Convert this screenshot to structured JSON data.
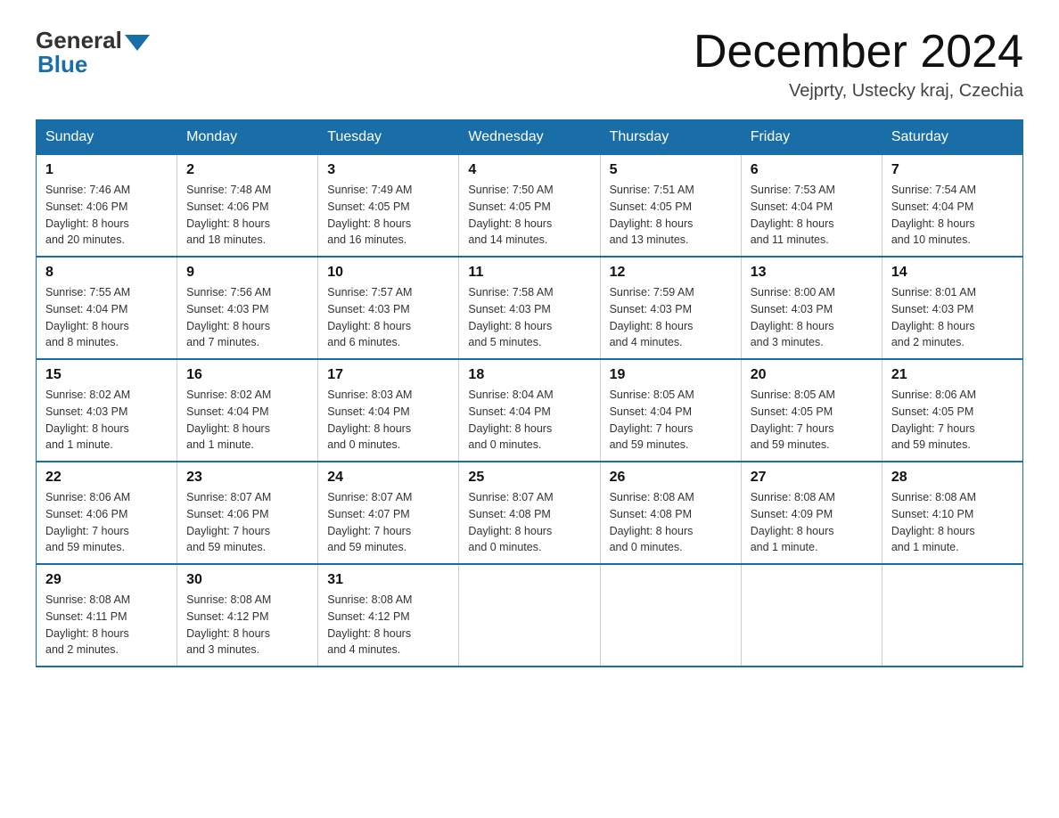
{
  "logo": {
    "general": "General",
    "blue": "Blue"
  },
  "title": "December 2024",
  "location": "Vejprty, Ustecky kraj, Czechia",
  "weekdays": [
    "Sunday",
    "Monday",
    "Tuesday",
    "Wednesday",
    "Thursday",
    "Friday",
    "Saturday"
  ],
  "weeks": [
    [
      {
        "day": "1",
        "sunrise": "7:46 AM",
        "sunset": "4:06 PM",
        "daylight": "8 hours and 20 minutes."
      },
      {
        "day": "2",
        "sunrise": "7:48 AM",
        "sunset": "4:06 PM",
        "daylight": "8 hours and 18 minutes."
      },
      {
        "day": "3",
        "sunrise": "7:49 AM",
        "sunset": "4:05 PM",
        "daylight": "8 hours and 16 minutes."
      },
      {
        "day": "4",
        "sunrise": "7:50 AM",
        "sunset": "4:05 PM",
        "daylight": "8 hours and 14 minutes."
      },
      {
        "day": "5",
        "sunrise": "7:51 AM",
        "sunset": "4:05 PM",
        "daylight": "8 hours and 13 minutes."
      },
      {
        "day": "6",
        "sunrise": "7:53 AM",
        "sunset": "4:04 PM",
        "daylight": "8 hours and 11 minutes."
      },
      {
        "day": "7",
        "sunrise": "7:54 AM",
        "sunset": "4:04 PM",
        "daylight": "8 hours and 10 minutes."
      }
    ],
    [
      {
        "day": "8",
        "sunrise": "7:55 AM",
        "sunset": "4:04 PM",
        "daylight": "8 hours and 8 minutes."
      },
      {
        "day": "9",
        "sunrise": "7:56 AM",
        "sunset": "4:03 PM",
        "daylight": "8 hours and 7 minutes."
      },
      {
        "day": "10",
        "sunrise": "7:57 AM",
        "sunset": "4:03 PM",
        "daylight": "8 hours and 6 minutes."
      },
      {
        "day": "11",
        "sunrise": "7:58 AM",
        "sunset": "4:03 PM",
        "daylight": "8 hours and 5 minutes."
      },
      {
        "day": "12",
        "sunrise": "7:59 AM",
        "sunset": "4:03 PM",
        "daylight": "8 hours and 4 minutes."
      },
      {
        "day": "13",
        "sunrise": "8:00 AM",
        "sunset": "4:03 PM",
        "daylight": "8 hours and 3 minutes."
      },
      {
        "day": "14",
        "sunrise": "8:01 AM",
        "sunset": "4:03 PM",
        "daylight": "8 hours and 2 minutes."
      }
    ],
    [
      {
        "day": "15",
        "sunrise": "8:02 AM",
        "sunset": "4:03 PM",
        "daylight": "8 hours and 1 minute."
      },
      {
        "day": "16",
        "sunrise": "8:02 AM",
        "sunset": "4:04 PM",
        "daylight": "8 hours and 1 minute."
      },
      {
        "day": "17",
        "sunrise": "8:03 AM",
        "sunset": "4:04 PM",
        "daylight": "8 hours and 0 minutes."
      },
      {
        "day": "18",
        "sunrise": "8:04 AM",
        "sunset": "4:04 PM",
        "daylight": "8 hours and 0 minutes."
      },
      {
        "day": "19",
        "sunrise": "8:05 AM",
        "sunset": "4:04 PM",
        "daylight": "7 hours and 59 minutes."
      },
      {
        "day": "20",
        "sunrise": "8:05 AM",
        "sunset": "4:05 PM",
        "daylight": "7 hours and 59 minutes."
      },
      {
        "day": "21",
        "sunrise": "8:06 AM",
        "sunset": "4:05 PM",
        "daylight": "7 hours and 59 minutes."
      }
    ],
    [
      {
        "day": "22",
        "sunrise": "8:06 AM",
        "sunset": "4:06 PM",
        "daylight": "7 hours and 59 minutes."
      },
      {
        "day": "23",
        "sunrise": "8:07 AM",
        "sunset": "4:06 PM",
        "daylight": "7 hours and 59 minutes."
      },
      {
        "day": "24",
        "sunrise": "8:07 AM",
        "sunset": "4:07 PM",
        "daylight": "7 hours and 59 minutes."
      },
      {
        "day": "25",
        "sunrise": "8:07 AM",
        "sunset": "4:08 PM",
        "daylight": "8 hours and 0 minutes."
      },
      {
        "day": "26",
        "sunrise": "8:08 AM",
        "sunset": "4:08 PM",
        "daylight": "8 hours and 0 minutes."
      },
      {
        "day": "27",
        "sunrise": "8:08 AM",
        "sunset": "4:09 PM",
        "daylight": "8 hours and 1 minute."
      },
      {
        "day": "28",
        "sunrise": "8:08 AM",
        "sunset": "4:10 PM",
        "daylight": "8 hours and 1 minute."
      }
    ],
    [
      {
        "day": "29",
        "sunrise": "8:08 AM",
        "sunset": "4:11 PM",
        "daylight": "8 hours and 2 minutes."
      },
      {
        "day": "30",
        "sunrise": "8:08 AM",
        "sunset": "4:12 PM",
        "daylight": "8 hours and 3 minutes."
      },
      {
        "day": "31",
        "sunrise": "8:08 AM",
        "sunset": "4:12 PM",
        "daylight": "8 hours and 4 minutes."
      },
      null,
      null,
      null,
      null
    ]
  ],
  "labels": {
    "sunrise": "Sunrise:",
    "sunset": "Sunset:",
    "daylight": "Daylight:"
  }
}
